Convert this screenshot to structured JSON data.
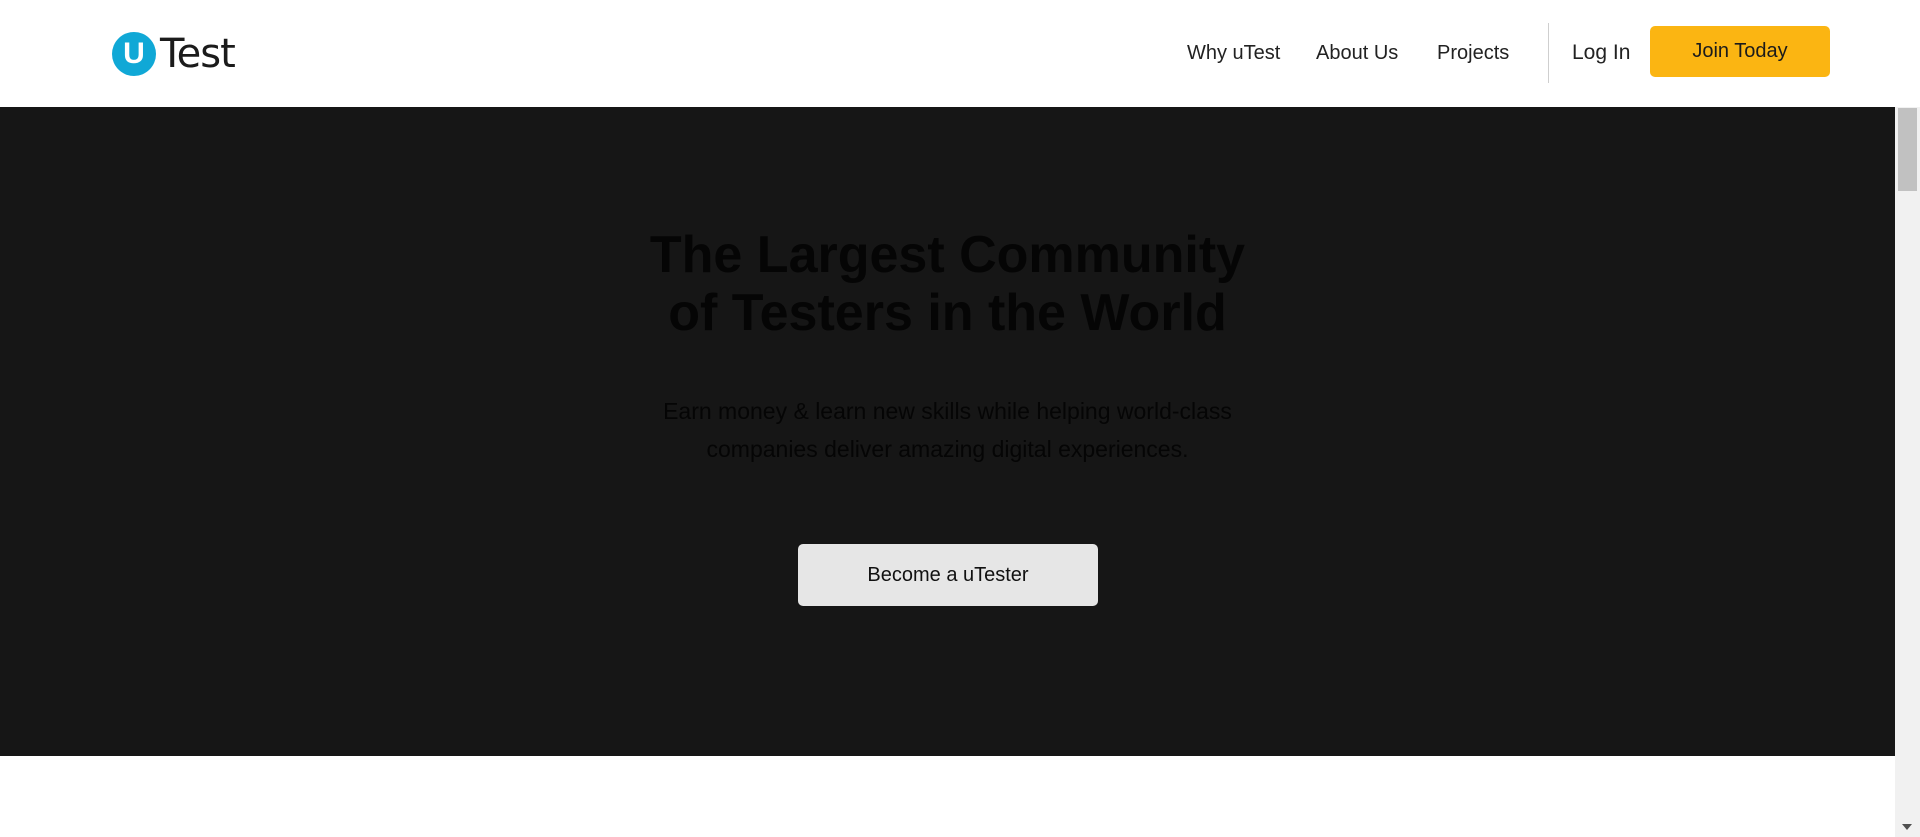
{
  "header": {
    "logo": {
      "mark": "U",
      "word": "Test"
    },
    "nav": {
      "why": "Why uTest",
      "about": "About Us",
      "projects": "Projects"
    },
    "login": "Log In",
    "join": "Join Today"
  },
  "hero": {
    "title_line1": "The Largest Community",
    "title_line2": "of Testers in the World",
    "subtitle_line1": "Earn money & learn new skills while helping world-class",
    "subtitle_line2": "companies deliver amazing digital experiences.",
    "cta": "Become a uTester"
  },
  "colors": {
    "brand_blue": "#10a8d6",
    "join_yellow": "#fbb512",
    "hero_background": "#161616",
    "cta_background": "#e6e6e6"
  },
  "icons": {
    "logo": "utest-logo-icon",
    "scroll_down": "scroll-down-arrow-icon"
  }
}
